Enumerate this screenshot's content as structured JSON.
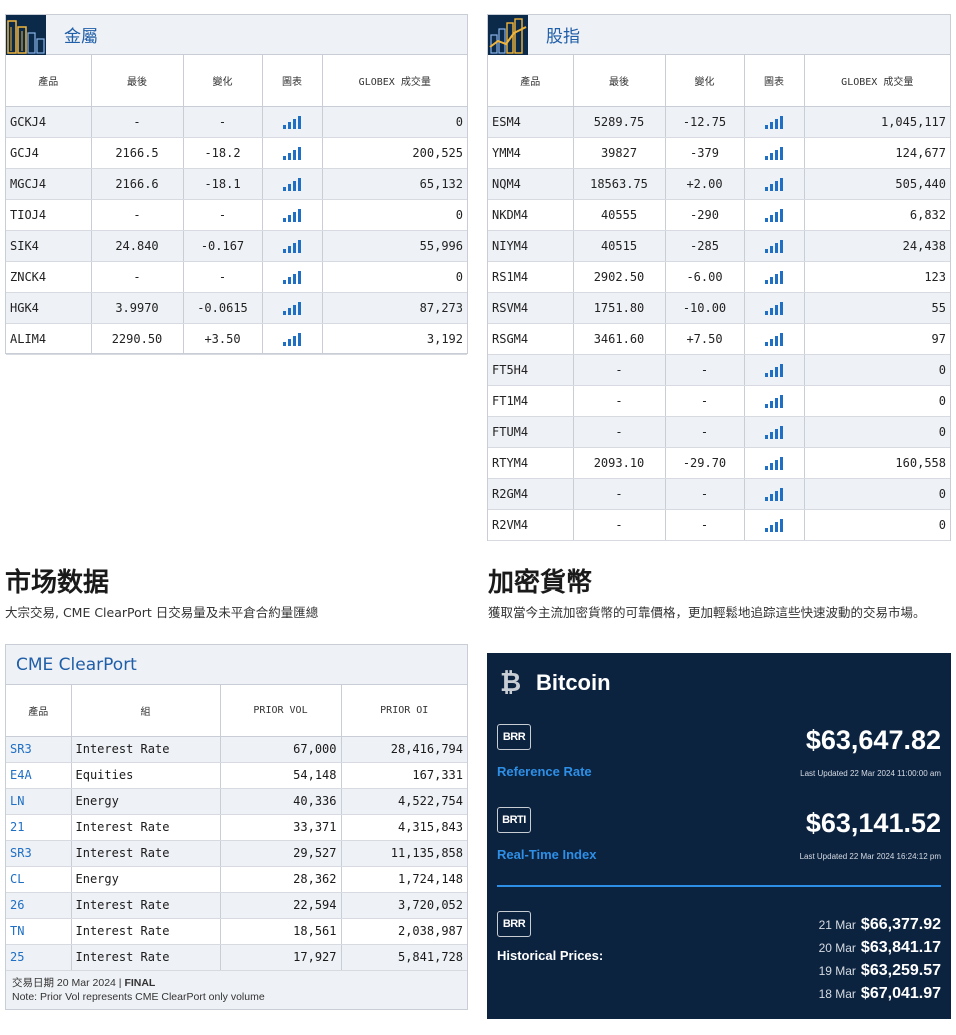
{
  "metals": {
    "title": "金屬",
    "headers": [
      "產品",
      "最後",
      "變化",
      "圖表",
      "GLOBEX 成交量"
    ],
    "rows": [
      {
        "symbol": "GCKJ4",
        "last": "-",
        "change": "-",
        "volume": "0"
      },
      {
        "symbol": "GCJ4",
        "last": "2166.5",
        "change": "-18.2",
        "volume": "200,525"
      },
      {
        "symbol": "MGCJ4",
        "last": "2166.6",
        "change": "-18.1",
        "volume": "65,132"
      },
      {
        "symbol": "TIOJ4",
        "last": "-",
        "change": "-",
        "volume": "0"
      },
      {
        "symbol": "SIK4",
        "last": "24.840",
        "change": "-0.167",
        "volume": "55,996"
      },
      {
        "symbol": "ZNCK4",
        "last": "-",
        "change": "-",
        "volume": "0"
      },
      {
        "symbol": "HGK4",
        "last": "3.9970",
        "change": "-0.0615",
        "volume": "87,273"
      },
      {
        "symbol": "ALIM4",
        "last": "2290.50",
        "change": "+3.50",
        "volume": "3,192"
      }
    ]
  },
  "indices": {
    "title": "股指",
    "headers": [
      "產品",
      "最後",
      "變化",
      "圖表",
      "GLOBEX 成交量"
    ],
    "rows": [
      {
        "symbol": "ESM4",
        "last": "5289.75",
        "change": "-12.75",
        "volume": "1,045,117"
      },
      {
        "symbol": "YMM4",
        "last": "39827",
        "change": "-379",
        "volume": "124,677"
      },
      {
        "symbol": "NQM4",
        "last": "18563.75",
        "change": "+2.00",
        "volume": "505,440"
      },
      {
        "symbol": "NKDM4",
        "last": "40555",
        "change": "-290",
        "volume": "6,832"
      },
      {
        "symbol": "NIYM4",
        "last": "40515",
        "change": "-285",
        "volume": "24,438"
      },
      {
        "symbol": "RS1M4",
        "last": "2902.50",
        "change": "-6.00",
        "volume": "123"
      },
      {
        "symbol": "RSVM4",
        "last": "1751.80",
        "change": "-10.00",
        "volume": "55"
      },
      {
        "symbol": "RSGM4",
        "last": "3461.60",
        "change": "+7.50",
        "volume": "97"
      },
      {
        "symbol": "FT5H4",
        "last": "-",
        "change": "-",
        "volume": "0"
      },
      {
        "symbol": "FT1M4",
        "last": "-",
        "change": "-",
        "volume": "0"
      },
      {
        "symbol": "FTUM4",
        "last": "-",
        "change": "-",
        "volume": "0"
      },
      {
        "symbol": "RTYM4",
        "last": "2093.10",
        "change": "-29.70",
        "volume": "160,558"
      },
      {
        "symbol": "R2GM4",
        "last": "-",
        "change": "-",
        "volume": "0"
      },
      {
        "symbol": "R2VM4",
        "last": "-",
        "change": "-",
        "volume": "0"
      }
    ]
  },
  "market_data": {
    "title": "市场数据",
    "subtitle": "大宗交易, CME ClearPort 日交易量及未平倉合約量匯總"
  },
  "clearport": {
    "title": "CME ClearPort",
    "headers": [
      "產品",
      "組",
      "PRIOR VOL",
      "PRIOR OI"
    ],
    "rows": [
      {
        "product": "SR3",
        "group": "Interest Rate",
        "vol": "67,000",
        "oi": "28,416,794"
      },
      {
        "product": "E4A",
        "group": "Equities",
        "vol": "54,148",
        "oi": "167,331"
      },
      {
        "product": "LN",
        "group": "Energy",
        "vol": "40,336",
        "oi": "4,522,754"
      },
      {
        "product": "21",
        "group": "Interest Rate",
        "vol": "33,371",
        "oi": "4,315,843"
      },
      {
        "product": "SR3",
        "group": "Interest Rate",
        "vol": "29,527",
        "oi": "11,135,858"
      },
      {
        "product": "CL",
        "group": "Energy",
        "vol": "28,362",
        "oi": "1,724,148"
      },
      {
        "product": "26",
        "group": "Interest Rate",
        "vol": "22,594",
        "oi": "3,720,052"
      },
      {
        "product": "TN",
        "group": "Interest Rate",
        "vol": "18,561",
        "oi": "2,038,987"
      },
      {
        "product": "25",
        "group": "Interest Rate",
        "vol": "17,927",
        "oi": "5,841,728"
      }
    ],
    "trade_date_prefix": "交易日期 20 Mar 2024 | ",
    "trade_date_status": "FINAL",
    "note": "Note: Prior Vol represents CME ClearPort only volume"
  },
  "crypto": {
    "title": "加密貨幣",
    "subtitle": "獲取當今主流加密貨幣的可靠價格，更加輕鬆地追踪這些快速波動的交易市場。",
    "coin_symbol": "₿",
    "coin_name": "Bitcoin",
    "brr_tag": "BRR",
    "brti_tag": "BRTI",
    "reference_label": "Reference Rate",
    "reference_price": "$63,647.82",
    "reference_updated": "Last Updated 22 Mar 2024 11:00:00 am",
    "realtime_label": "Real-Time Index",
    "realtime_price": "$63,141.52",
    "realtime_updated": "Last Updated 22 Mar 2024 16:24:12 pm",
    "historical_tag": "BRR",
    "historical_label": "Historical Prices:",
    "historical": [
      {
        "date": "21 Mar",
        "price": "$66,377.92"
      },
      {
        "date": "20 Mar",
        "price": "$63,841.17"
      },
      {
        "date": "19 Mar",
        "price": "$63,259.57"
      },
      {
        "date": "18 Mar",
        "price": "$67,041.97"
      }
    ]
  },
  "colors": {
    "accent_blue": "#1f6fc4",
    "negative_green": "#2e8b3a",
    "positive_red": "#d0302a",
    "crypto_bg": "#0c2340",
    "crypto_label_blue": "#2d8fe6"
  },
  "icons": {
    "chart_cell": "bar-chart-icon",
    "metals_panel": "metals-buildings-icon",
    "indices_panel": "indices-chart-icon",
    "coin": "bitcoin-icon"
  }
}
